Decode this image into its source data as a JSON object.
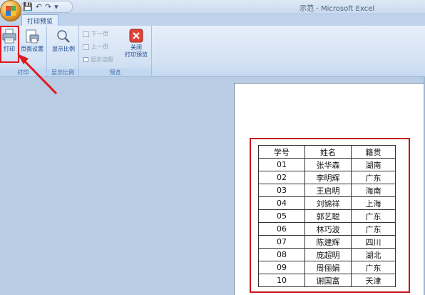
{
  "window": {
    "title": "示范 - Microsoft Excel",
    "qat": [
      "save-icon",
      "undo-icon",
      "redo-icon",
      "customize-icon"
    ]
  },
  "tabs": [
    {
      "label": "打印预览",
      "active": true
    }
  ],
  "ribbon": {
    "groups": [
      {
        "label": "打印",
        "buttons": [
          {
            "label": "打印",
            "icon": "printer-icon"
          },
          {
            "label": "页面设置",
            "icon": "page-setup-icon"
          }
        ]
      },
      {
        "label": "显示比例",
        "buttons": [
          {
            "label": "显示比例",
            "icon": "zoom-icon"
          }
        ]
      },
      {
        "label": "预览",
        "buttons": [
          {
            "label": "下一页",
            "icon": "next-page-icon",
            "enabled": false
          },
          {
            "label": "上一页",
            "icon": "prev-page-icon",
            "enabled": false
          },
          {
            "label": "显示边距",
            "icon": "checkbox-icon",
            "enabled": false
          },
          {
            "label": "关闭\n打印预览",
            "line1": "关闭",
            "line2": "打印预览",
            "icon": "close-preview-icon"
          }
        ]
      }
    ]
  },
  "table": {
    "headers": [
      "学号",
      "姓名",
      "籍贯"
    ],
    "rows": [
      [
        "01",
        "张华森",
        "湖南"
      ],
      [
        "02",
        "李明辉",
        "广东"
      ],
      [
        "03",
        "王启明",
        "海南"
      ],
      [
        "04",
        "刘锦祥",
        "上海"
      ],
      [
        "05",
        "郭艺聪",
        "广东"
      ],
      [
        "06",
        "林巧波",
        "广东"
      ],
      [
        "07",
        "陈建辉",
        "四川"
      ],
      [
        "08",
        "庞超明",
        "湖北"
      ],
      [
        "09",
        "周俪娟",
        "广东"
      ],
      [
        "10",
        "谢国富",
        "天津"
      ]
    ]
  },
  "colors": {
    "highlight": "#e0191f",
    "ribbon_text": "#15428b",
    "background": "#b8cce4"
  }
}
